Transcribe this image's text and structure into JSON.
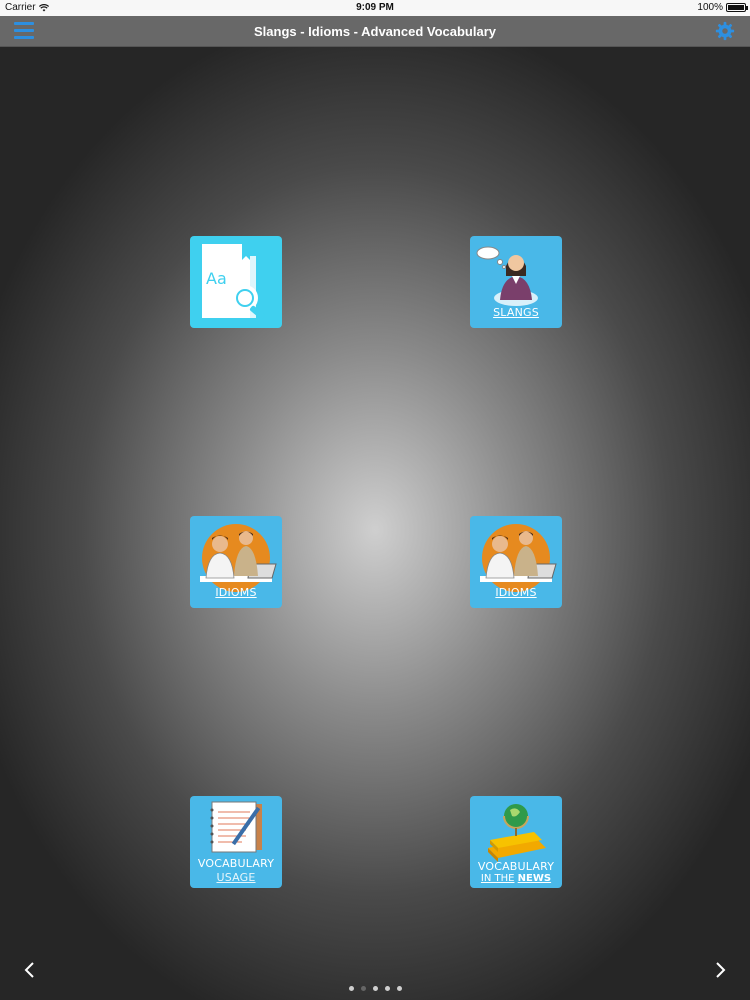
{
  "status_bar": {
    "carrier": "Carrier",
    "time": "9:09 PM",
    "battery": "100%",
    "battery_level": 1.0
  },
  "nav": {
    "title": "Slangs - Idioms - Advanced Vocabulary",
    "menu_icon": "hamburger-menu-icon",
    "settings_icon": "gear-icon"
  },
  "tiles": [
    {
      "id": "dictionary",
      "icon": "dictionary-search-icon",
      "label_line1": "Aa"
    },
    {
      "id": "slangs",
      "icon": "person-speech-icon",
      "label": "SLANGS"
    },
    {
      "id": "idioms-1",
      "icon": "business-people-icon",
      "label": "IDIOMS"
    },
    {
      "id": "idioms-2",
      "icon": "business-people-icon",
      "label": "IDIOMS"
    },
    {
      "id": "vocab-usage",
      "icon": "notepad-pen-icon",
      "label_line1": "VOCABULARY",
      "label_line2": "USAGE"
    },
    {
      "id": "vocab-news",
      "icon": "globe-books-icon",
      "label_line1": "VOCABULARY",
      "label_line2_a": "IN THE",
      "label_line2_b": "NEWS"
    }
  ],
  "pager": {
    "pages": 5,
    "current_index": 1
  },
  "colors": {
    "accent": "#2d8fe0",
    "tile": "#49b8e8",
    "navbar": "#686868"
  }
}
